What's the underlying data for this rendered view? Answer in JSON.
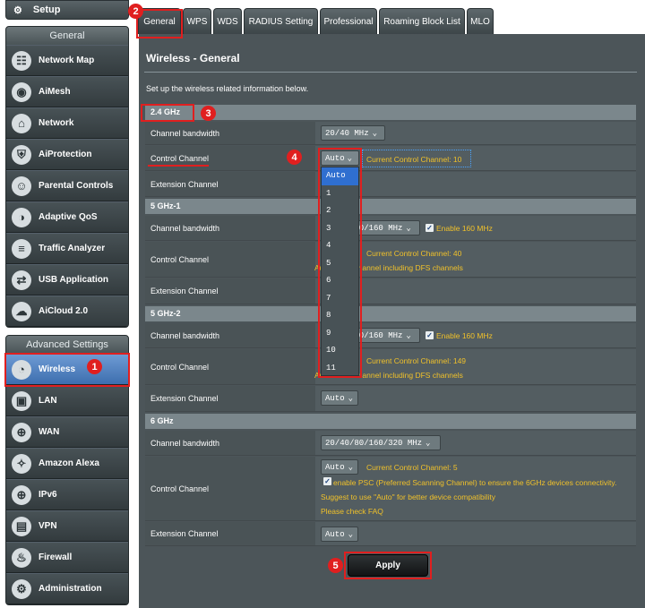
{
  "sidebar": {
    "setup_label": "Setup",
    "general_header": "General",
    "general_items": [
      {
        "label": "Network Map",
        "icon": "network-map-icon",
        "glyph": "☷"
      },
      {
        "label": "AiMesh",
        "icon": "aimesh-icon",
        "glyph": "◉"
      },
      {
        "label": "Network",
        "icon": "network-icon",
        "glyph": "⌂"
      },
      {
        "label": "AiProtection",
        "icon": "shield-icon",
        "glyph": "⛨"
      },
      {
        "label": "Parental Controls",
        "icon": "family-icon",
        "glyph": "☺"
      },
      {
        "label": "Adaptive QoS",
        "icon": "gauge-icon",
        "glyph": "◑"
      },
      {
        "label": "Traffic Analyzer",
        "icon": "analyzer-icon",
        "glyph": "≡"
      },
      {
        "label": "USB Application",
        "icon": "usb-icon",
        "glyph": "⇄"
      },
      {
        "label": "AiCloud 2.0",
        "icon": "cloud-icon",
        "glyph": "☁"
      }
    ],
    "advanced_header": "Advanced Settings",
    "advanced_items": [
      {
        "label": "Wireless",
        "icon": "wifi-icon",
        "glyph": "◔"
      },
      {
        "label": "LAN",
        "icon": "lan-icon",
        "glyph": "▣"
      },
      {
        "label": "WAN",
        "icon": "globe-icon",
        "glyph": "⊕"
      },
      {
        "label": "Amazon Alexa",
        "icon": "alexa-icon",
        "glyph": "✧"
      },
      {
        "label": "IPv6",
        "icon": "ipv6-icon",
        "glyph": "⊕"
      },
      {
        "label": "VPN",
        "icon": "vpn-icon",
        "glyph": "▤"
      },
      {
        "label": "Firewall",
        "icon": "firewall-icon",
        "glyph": "♨"
      },
      {
        "label": "Administration",
        "icon": "admin-icon",
        "glyph": "⚙"
      }
    ]
  },
  "tabs": [
    "General",
    "WPS",
    "WDS",
    "RADIUS Setting",
    "Professional",
    "Roaming Block List",
    "MLO"
  ],
  "page": {
    "title": "Wireless - General",
    "description": "Set up the wireless related information below."
  },
  "sections": {
    "band24": {
      "header": "2.4 GHz",
      "bandwidth_label": "Channel bandwidth",
      "bandwidth_value": "20/40 MHz",
      "control_label": "Control Channel",
      "control_value": "Auto",
      "control_hint": "Current Control Channel: 10",
      "extension_label": "Extension Channel"
    },
    "band5_1": {
      "header": "5 GHz-1",
      "bandwidth_label": "Channel bandwidth",
      "bandwidth_value": "20/40/80/160 MHz",
      "enable160": "Enable 160 MHz",
      "control_label": "Control Channel",
      "control_hint": "Current Control Channel: 40",
      "dfs_hint": "Auto select channel including DFS channels",
      "extension_label": "Extension Channel"
    },
    "band5_2": {
      "header": "5 GHz-2",
      "bandwidth_label": "Channel bandwidth",
      "bandwidth_value": "20/40/80/160 MHz",
      "enable160": "Enable 160 MHz",
      "control_label": "Control Channel",
      "control_hint": "Current Control Channel: 149",
      "dfs_hint": "Auto select channel including DFS channels",
      "extension_label": "Extension Channel",
      "extension_value": "Auto"
    },
    "band6": {
      "header": "6 GHz",
      "bandwidth_label": "Channel bandwidth",
      "bandwidth_value": "20/40/80/160/320 MHz",
      "control_label": "Control Channel",
      "control_value": "Auto",
      "control_hint": "Current Control Channel: 5",
      "psc_text": "enable PSC (Preferred Scanning Channel) to ensure the 6GHz devices connectivity.",
      "suggest_text": "Suggest to use \"Auto\" for better device compatibility",
      "faq_text": "Please check FAQ",
      "extension_label": "Extension Channel",
      "extension_value": "Auto"
    }
  },
  "dropdown_options": [
    "Auto",
    "1",
    "2",
    "3",
    "4",
    "5",
    "6",
    "7",
    "8",
    "9",
    "10",
    "11"
  ],
  "apply_label": "Apply",
  "step_markers": [
    "1",
    "2",
    "3",
    "4",
    "5"
  ],
  "colors": {
    "highlight": "#e01f1f",
    "hint": "#f0c12a",
    "selected_option": "#2f6fd0"
  }
}
